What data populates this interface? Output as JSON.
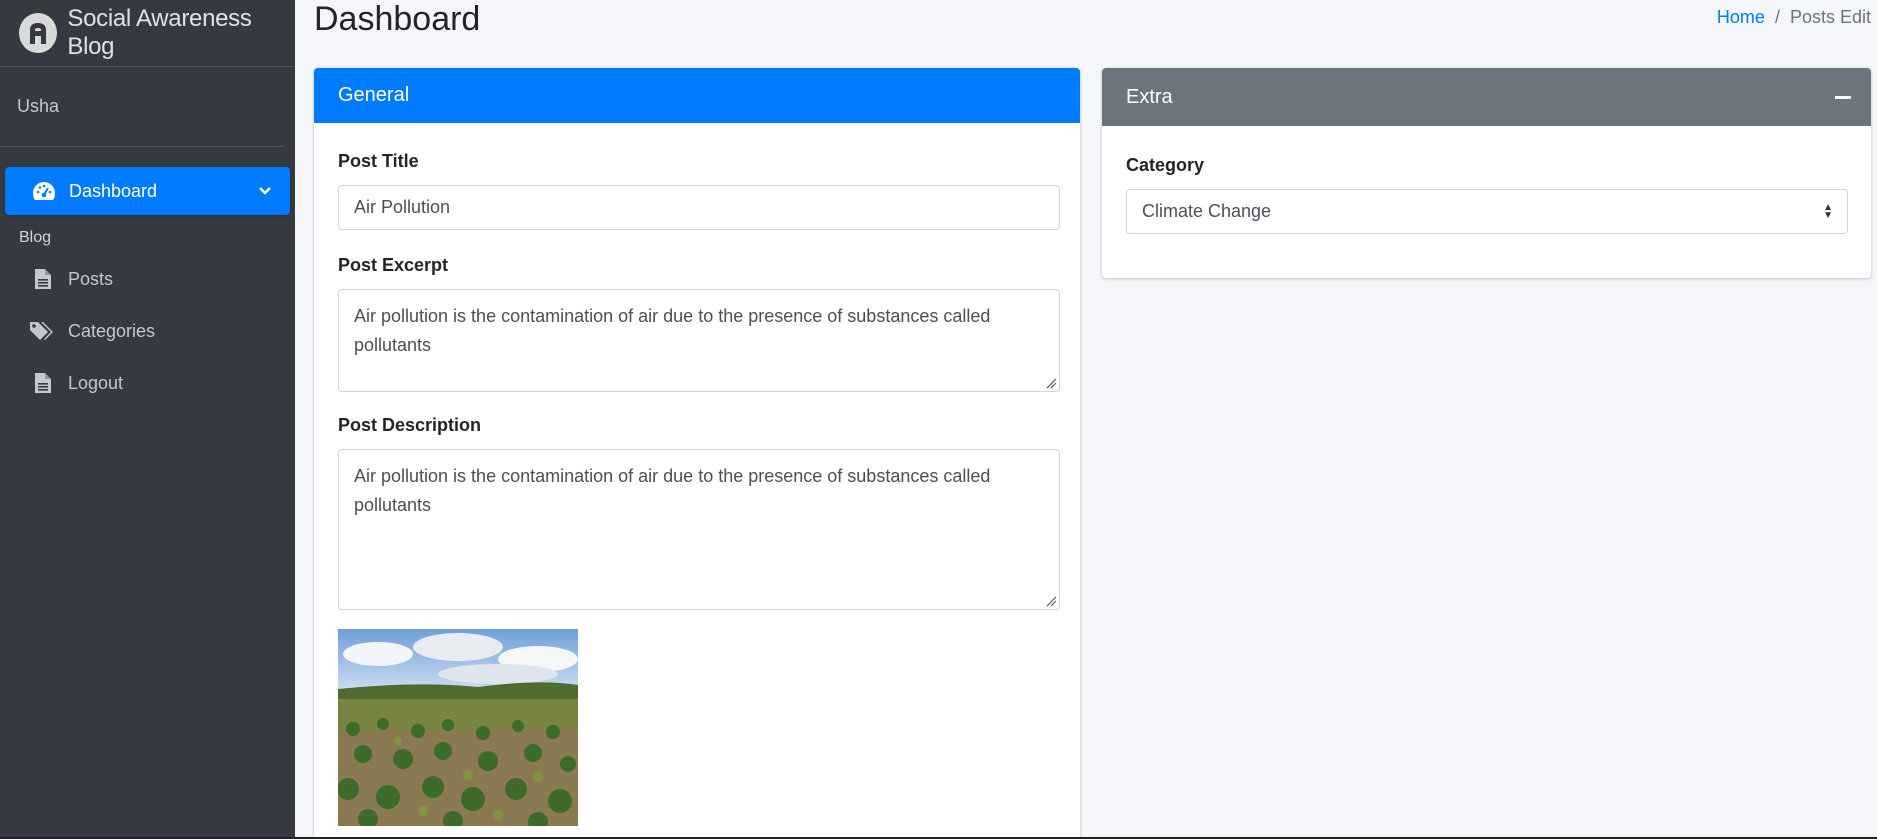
{
  "brand": {
    "name": "Social Awareness Blog",
    "logo_icon": "brand-logo-icon"
  },
  "user": {
    "name": "Usha"
  },
  "sidebar": {
    "dashboard": {
      "label": "Dashboard",
      "icon": "tachometer-icon"
    },
    "header": "Blog",
    "items": [
      {
        "label": "Posts",
        "icon": "file-icon"
      },
      {
        "label": "Categories",
        "icon": "tags-icon"
      },
      {
        "label": "Logout",
        "icon": "file-icon"
      }
    ]
  },
  "page": {
    "title": "Dashboard"
  },
  "breadcrumb": {
    "home": "Home",
    "separator": "/",
    "current": "Posts Edit"
  },
  "general_card": {
    "title": "General",
    "post_title_label": "Post Title",
    "post_title_value": "Air Pollution",
    "excerpt_label": "Post Excerpt",
    "excerpt_value": "Air pollution is the contamination of air due to the presence of substances called pollutants",
    "description_label": "Post Description",
    "description_value": "Air pollution is the contamination of air due to the presence of substances called pollutants",
    "image": "field-landscape-image"
  },
  "extra_card": {
    "title": "Extra",
    "category_label": "Category",
    "category_value": "Climate Change"
  },
  "colors": {
    "primary": "#007bff",
    "secondary": "#6c757d",
    "sidebar": "#343a40",
    "background": "#f4f6f9"
  }
}
